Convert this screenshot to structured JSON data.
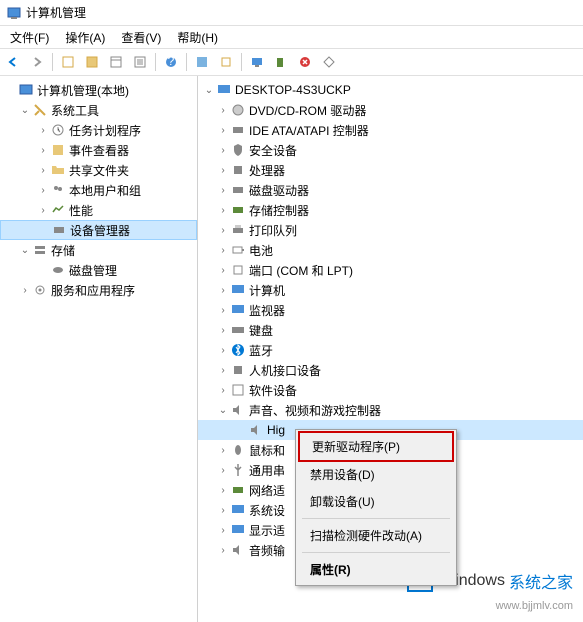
{
  "titlebar": {
    "title": "计算机管理"
  },
  "menubar": {
    "file": "文件(F)",
    "action": "操作(A)",
    "view": "查看(V)",
    "help": "帮助(H)"
  },
  "left_tree": {
    "root": "计算机管理(本地)",
    "system_tools": "系统工具",
    "task_scheduler": "任务计划程序",
    "event_viewer": "事件查看器",
    "shared_folders": "共享文件夹",
    "local_users": "本地用户和组",
    "performance": "性能",
    "device_manager": "设备管理器",
    "storage": "存储",
    "disk_management": "磁盘管理",
    "services_apps": "服务和应用程序"
  },
  "right_tree": {
    "root": "DESKTOP-4S3UCKP",
    "dvd": "DVD/CD-ROM 驱动器",
    "ide": "IDE ATA/ATAPI 控制器",
    "security": "安全设备",
    "processor": "处理器",
    "disk": "磁盘驱动器",
    "storage_ctrl": "存储控制器",
    "print_queue": "打印队列",
    "battery": "电池",
    "ports": "端口 (COM 和 LPT)",
    "computer": "计算机",
    "monitor": "监视器",
    "keyboard": "键盘",
    "bluetooth": "蓝牙",
    "hid": "人机接口设备",
    "software": "软件设备",
    "sound": "声音、视频和游戏控制器",
    "sound_hd": "Hig",
    "mouse": "鼠标和",
    "serial": "通用串",
    "network": "网络适",
    "system_dev": "系统设",
    "display": "显示适",
    "audio_in": "音频输"
  },
  "context_menu": {
    "update_driver": "更新驱动程序(P)",
    "disable": "禁用设备(D)",
    "uninstall": "卸载设备(U)",
    "scan": "扫描检测硬件改动(A)",
    "properties": "属性(R)"
  },
  "watermark": {
    "brand1": "Windows",
    "brand2": "系统之家",
    "url": "www.bjjmlv.com"
  }
}
